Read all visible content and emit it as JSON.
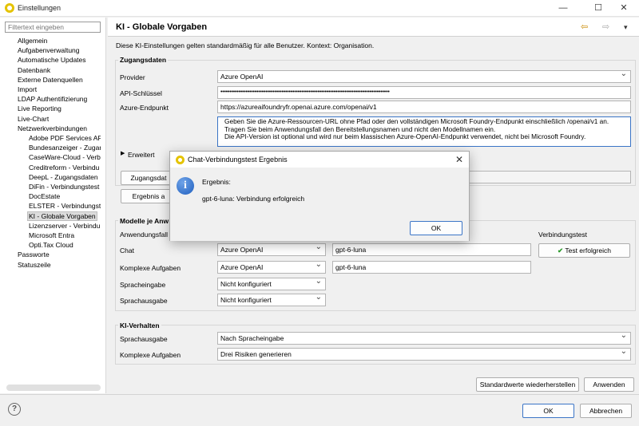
{
  "window": {
    "title": "Einstellungen",
    "controls": {
      "minimize": "—",
      "maximize": "☐",
      "close": "✕"
    }
  },
  "sidebar": {
    "filter_placeholder": "Filtertext eingeben",
    "items": [
      {
        "label": "Allgemein",
        "level": 0
      },
      {
        "label": "Aufgabenverwaltung",
        "level": 0
      },
      {
        "label": "Automatische Updates",
        "level": 0
      },
      {
        "label": "Datenbank",
        "level": 0
      },
      {
        "label": "Externe Datenquellen",
        "level": 0
      },
      {
        "label": "Import",
        "level": 0
      },
      {
        "label": "LDAP Authentifizierung",
        "level": 0
      },
      {
        "label": "Live Reporting",
        "level": 0
      },
      {
        "label": "Live-Chart",
        "level": 0
      },
      {
        "label": "Netzwerkverbindungen",
        "level": 0
      },
      {
        "label": "Adobe PDF Services AP",
        "level": 1
      },
      {
        "label": "Bundesanzeiger - Zugar",
        "level": 1
      },
      {
        "label": "CaseWare-Cloud - Verb",
        "level": 1
      },
      {
        "label": "Creditreform - Verbindu",
        "level": 1
      },
      {
        "label": "DeepL - Zugangsdaten",
        "level": 1
      },
      {
        "label": "DiFin - Verbindungstest",
        "level": 1
      },
      {
        "label": "DocEstate",
        "level": 1
      },
      {
        "label": "ELSTER - Verbindungste",
        "level": 1
      },
      {
        "label": "KI - Globale Vorgaben",
        "level": 1,
        "selected": true
      },
      {
        "label": "Lizenzserver - Verbindu",
        "level": 1
      },
      {
        "label": "Microsoft Entra",
        "level": 1
      },
      {
        "label": "Opti.Tax Cloud",
        "level": 1
      },
      {
        "label": "Passworte",
        "level": 0
      },
      {
        "label": "Statuszeile",
        "level": 0
      }
    ]
  },
  "page": {
    "title": "KI - Globale Vorgaben",
    "description": "Diese KI-Einstellungen gelten standardmäßig für alle Benutzer. Kontext: Organisation.",
    "nav_icons": [
      "⇦",
      "⇨",
      "▾"
    ]
  },
  "credentials": {
    "group_title": "Zugangsdaten",
    "provider_label": "Provider",
    "provider_value": "Azure OpenAI",
    "api_key_label": "API-Schlüssel",
    "api_key_value": "••••••••••••••••••••••••••••••••••••••••••••••••••••••••••••••••••••••••••••••••••••••••••••••",
    "endpoint_label": "Azure-Endpunkt",
    "endpoint_value": "https://azureaifoundryfr.openai.azure.com/openai/v1",
    "hint_lines": [
      "Geben Sie die Azure-Ressourcen-URL ohne Pfad oder den vollständigen Microsoft Foundry-Endpunkt einschließlich /openai/v1 an.",
      "Tragen Sie beim Anwendungsfall den Bereitstellungsnamen und nicht den Modellnamen ein.",
      "Die API-Version ist optional und wird nur beim klassischen Azure-OpenAI-Endpunkt verwendet, nicht bei Microsoft Foundry."
    ],
    "advanced_label": "Erweitert",
    "button_credentials": "Zugangsdat",
    "button_result": "Ergebnis a"
  },
  "models": {
    "group_title": "Modelle je Anw",
    "use_case_header": "Anwendungsfall",
    "conn_test_header": "Verbindungstest",
    "rows": [
      {
        "label": "Chat",
        "provider": "Azure OpenAI",
        "model": "gpt-6-luna"
      },
      {
        "label": "Komplexe Aufgaben",
        "provider": "Azure OpenAI",
        "model": "gpt-6-luna"
      },
      {
        "label": "Spracheingabe",
        "provider": "Nicht konfiguriert",
        "model": ""
      },
      {
        "label": "Sprachausgabe",
        "provider": "Nicht konfiguriert",
        "model": ""
      }
    ],
    "test_button": "Test erfolgreich"
  },
  "behavior": {
    "group_title": "KI-Verhalten",
    "rows": [
      {
        "label": "Sprachausgabe",
        "value": "Nach Spracheingabe"
      },
      {
        "label": "Komplexe Aufgaben",
        "value": "Drei Risiken generieren"
      }
    ]
  },
  "footer": {
    "restore_defaults": "Standardwerte wiederherstellen",
    "apply": "Anwenden",
    "ok": "OK",
    "cancel": "Abbrechen",
    "help": "?"
  },
  "dialog": {
    "title": "Chat-Verbindungstest Ergebnis",
    "heading": "Ergebnis:",
    "message": "gpt-6-luna: Verbindung erfolgreich",
    "ok": "OK",
    "close": "✕",
    "info_glyph": "i"
  },
  "colors": {
    "accent_blue": "#3a74c6",
    "success_green": "#2e9b2e",
    "brand_yellow": "#e5c300"
  }
}
